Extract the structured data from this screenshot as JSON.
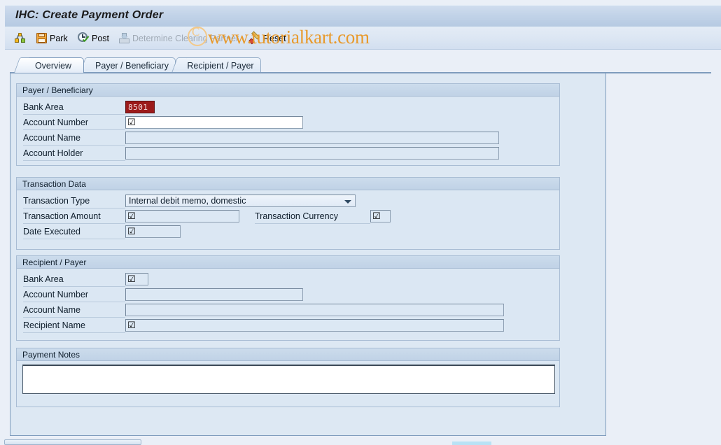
{
  "window": {
    "title": "IHC: Create Payment Order"
  },
  "watermark": {
    "text": "www.tutorialkart.com"
  },
  "toolbar": {
    "buttons": [
      {
        "label": "",
        "icon": "structure-icon",
        "enabled": true
      },
      {
        "label": "Park",
        "icon": "save-icon",
        "enabled": true
      },
      {
        "label": "Post",
        "icon": "post-clock-check-icon",
        "enabled": true
      },
      {
        "label": "Determine Clearing Partner",
        "icon": "determine-inbox-icon",
        "enabled": false
      },
      {
        "label": "Reset",
        "icon": "eraser-icon",
        "enabled": true
      }
    ]
  },
  "tabs": [
    {
      "label": "Overview",
      "active": true
    },
    {
      "label": "Payer / Beneficiary",
      "active": false
    },
    {
      "label": "Recipient / Payer",
      "active": false
    }
  ],
  "groups": {
    "payer": {
      "title": "Payer / Beneficiary",
      "fields": [
        {
          "label": "Bank Area",
          "value": "8501",
          "state": "required"
        },
        {
          "label": "Account Number",
          "value": "☑",
          "state": "editable"
        },
        {
          "label": "Account Name",
          "value": "",
          "state": "disabled"
        },
        {
          "label": "Account Holder",
          "value": "",
          "state": "disabled"
        }
      ]
    },
    "transaction": {
      "title": "Transaction Data",
      "type_label": "Transaction Type",
      "type_value": "Internal debit memo, domestic",
      "amount_label": "Transaction Amount",
      "amount_value": "☑",
      "currency_label": "Transaction Currency",
      "currency_value": "☑",
      "date_label": "Date Executed",
      "date_value": "☑"
    },
    "recipient": {
      "title": "Recipient / Payer",
      "fields": [
        {
          "label": "Bank Area",
          "value": "☑",
          "state": "editable-small"
        },
        {
          "label": "Account Number",
          "value": "",
          "state": "disabled"
        },
        {
          "label": "Account Name",
          "value": "",
          "state": "disabled"
        },
        {
          "label": "Recipient Name",
          "value": "☑",
          "state": "disabled"
        }
      ]
    },
    "notes": {
      "title": "Payment Notes",
      "value": ""
    }
  },
  "colors": {
    "required_field_bg": "#9c1a1a",
    "panel_bg": "#dde8f3",
    "title_bar": "#c2d3e8",
    "watermark": "#e89a2c"
  }
}
